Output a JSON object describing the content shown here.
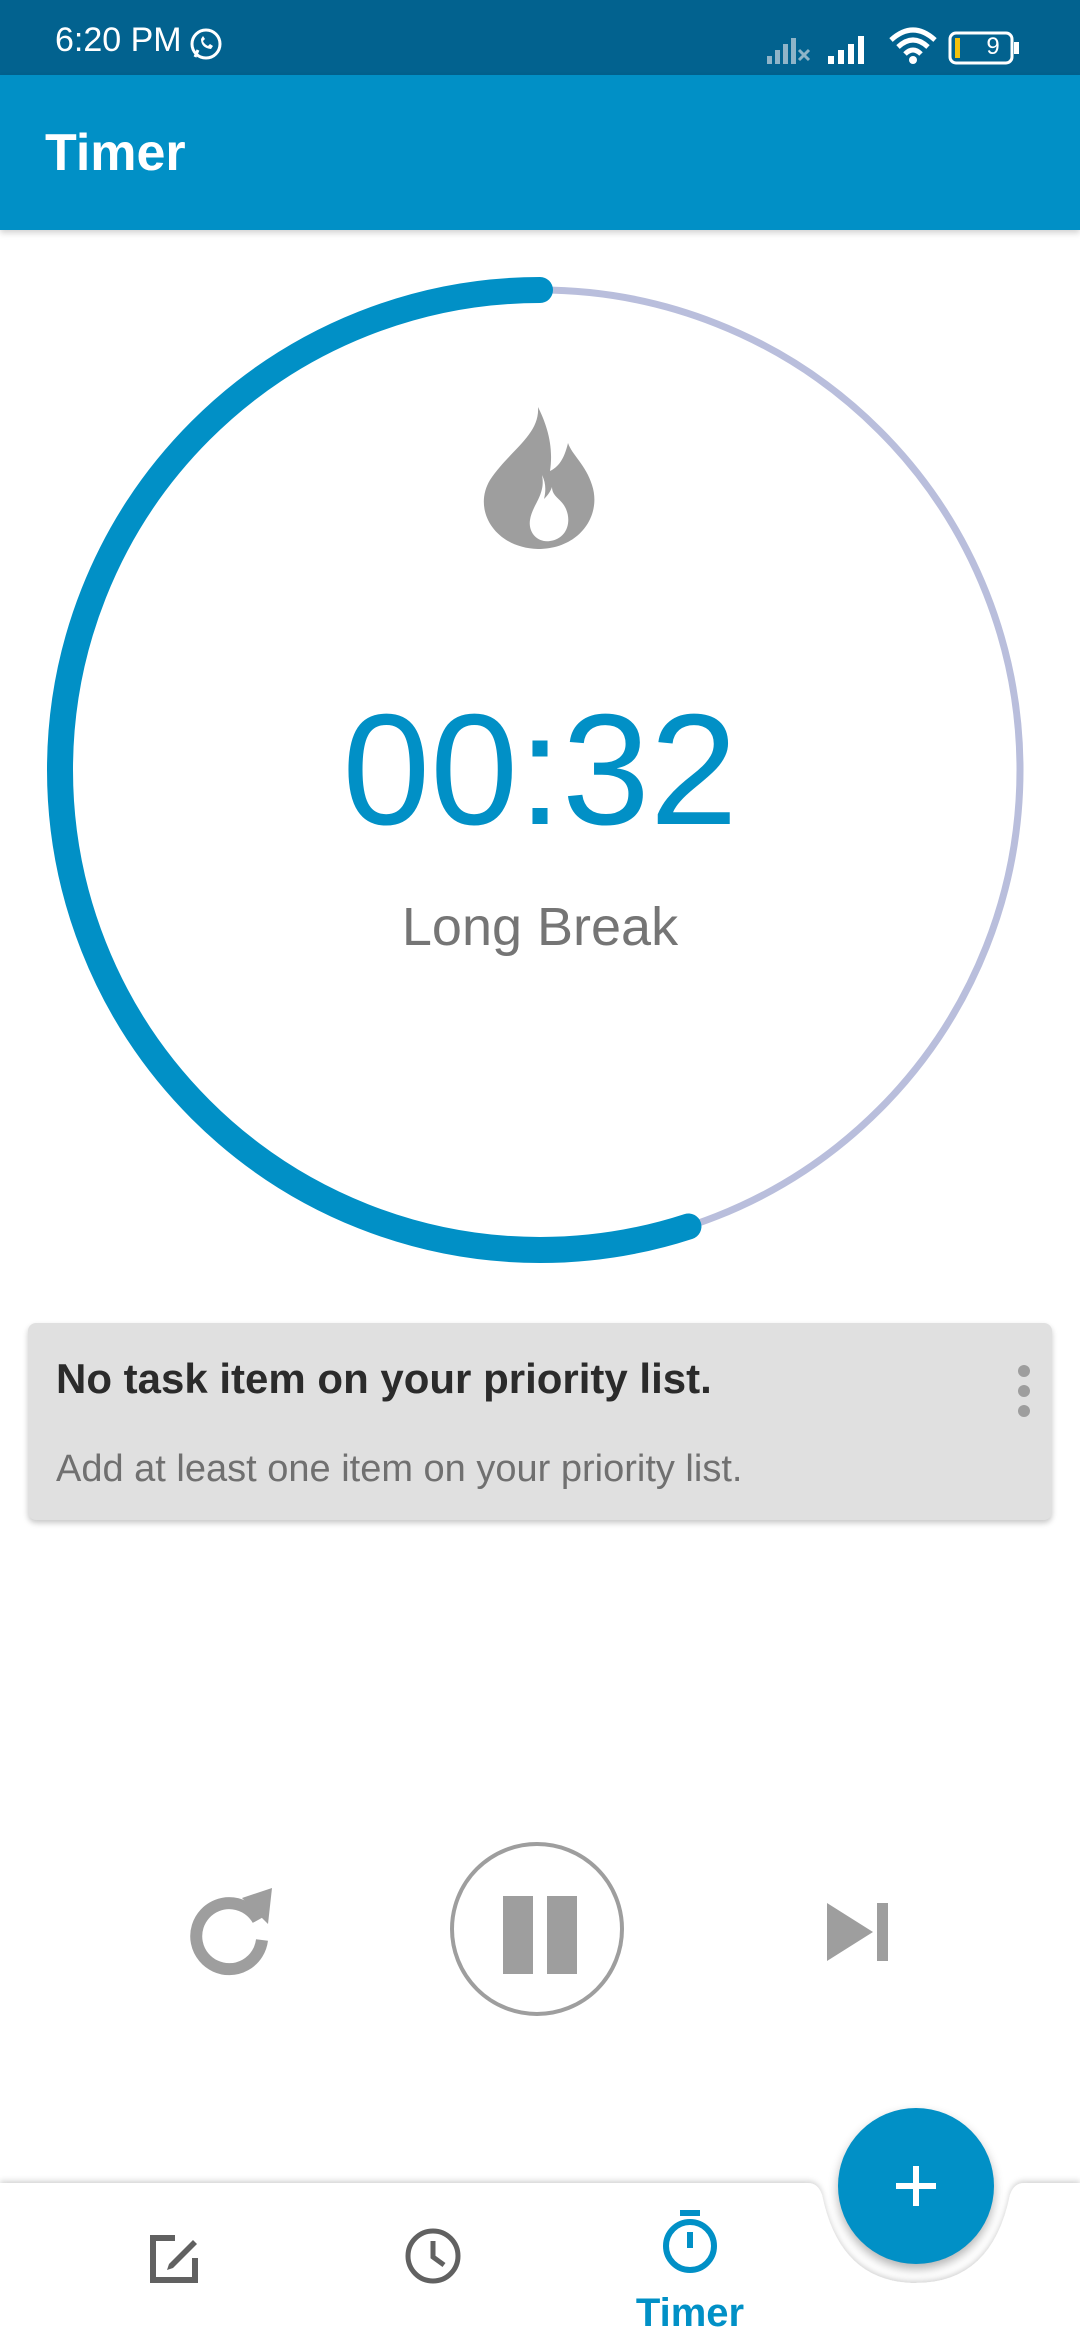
{
  "status_bar": {
    "time": "6:20 PM",
    "battery_level": "9",
    "icons": [
      "whatsapp-icon",
      "signal-no-service-icon",
      "signal-icon",
      "wifi-icon",
      "battery-icon"
    ]
  },
  "app_bar": {
    "title": "Timer"
  },
  "timer": {
    "time": "00:32",
    "mode": "Long Break",
    "icon": "fire-icon",
    "progress_fraction": 0.55,
    "colors": {
      "progress": "#0190c6",
      "track": "#b9bedc"
    }
  },
  "task_card": {
    "title": "No task item on your priority list.",
    "subtitle": "Add at least one item on your priority list."
  },
  "controls": {
    "icons": [
      "reset-icon",
      "pause-icon",
      "skip-next-icon"
    ]
  },
  "bottom_nav": {
    "items": [
      {
        "icon": "edit-icon",
        "label": ""
      },
      {
        "icon": "clock-icon",
        "label": ""
      },
      {
        "icon": "timer-icon",
        "label": "Timer",
        "active": true
      }
    ]
  },
  "fab": {
    "icon": "plus-icon"
  },
  "colors": {
    "accent": "#0190c6",
    "status_bar": "#02628f",
    "inactive": "#9e9e9e"
  }
}
